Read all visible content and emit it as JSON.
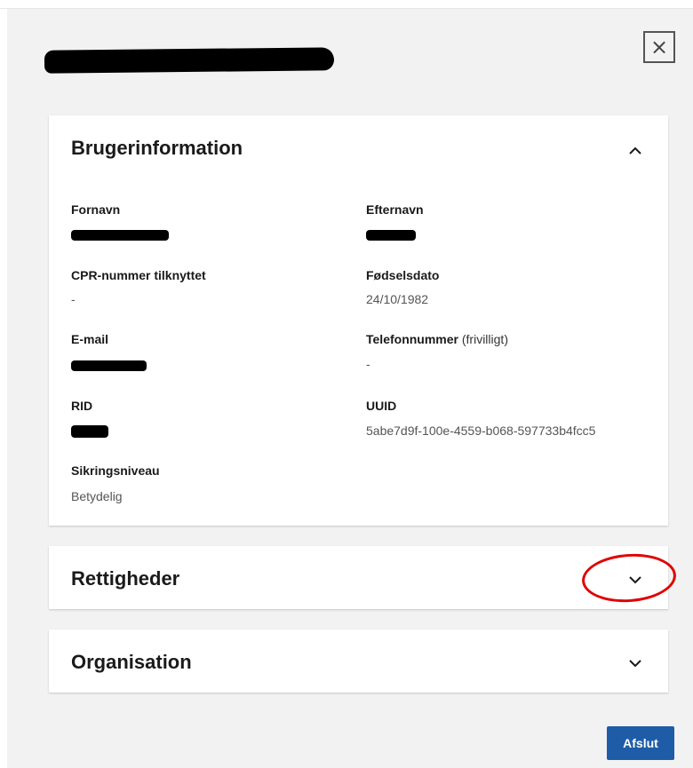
{
  "dialog": {
    "close_symbol": "×"
  },
  "brugerinformation": {
    "title": "Brugerinformation",
    "fields": {
      "fornavn": {
        "label": "Fornavn",
        "value": ""
      },
      "efternavn": {
        "label": "Efternavn",
        "value": ""
      },
      "cpr": {
        "label": "CPR-nummer tilknyttet",
        "value": "-"
      },
      "foedselsdato": {
        "label": "Fødselsdato",
        "value": "24/10/1982"
      },
      "email": {
        "label": "E-mail",
        "value": ""
      },
      "telefon": {
        "label": "Telefonnummer",
        "optional": "(frivilligt)",
        "value": "-"
      },
      "rid": {
        "label": "RID",
        "value": ""
      },
      "uuid": {
        "label": "UUID",
        "value": "5abe7d9f-100e-4559-b068-597733b4fcc5"
      },
      "sikringsniveau": {
        "label": "Sikringsniveau",
        "value": "Betydelig"
      }
    }
  },
  "rettigheder": {
    "title": "Rettigheder"
  },
  "organisation": {
    "title": "Organisation"
  },
  "footer": {
    "afslut_label": "Afslut"
  },
  "colors": {
    "primary_button": "#1f5ca8",
    "annotation_circle": "#e00000"
  },
  "icons": {
    "close": "close-icon",
    "collapse": "chevron-up-icon",
    "expand": "chevron-down-icon"
  }
}
